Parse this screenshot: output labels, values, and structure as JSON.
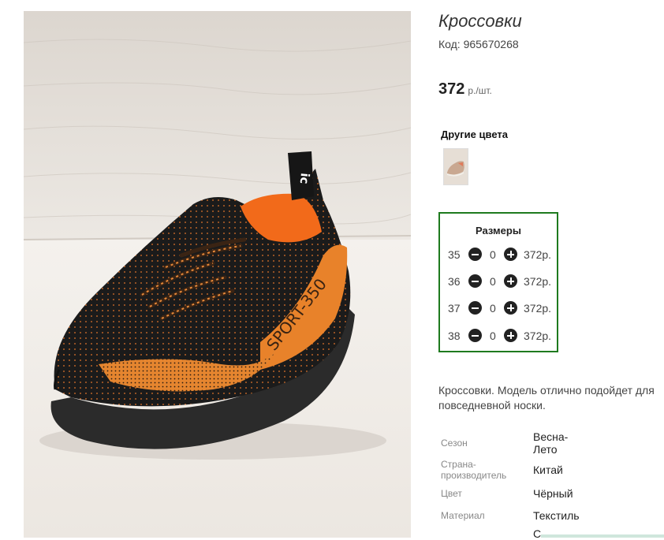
{
  "product": {
    "title": "Кроссовки",
    "code": "Код: 965670268",
    "price_amount": "372",
    "price_unit": "р./шт.",
    "other_colors_title": "Другие цвета",
    "sizes_title": "Размеры",
    "sizes": [
      {
        "size": "35",
        "qty": "0",
        "price": "372р."
      },
      {
        "size": "36",
        "qty": "0",
        "price": "372р."
      },
      {
        "size": "37",
        "qty": "0",
        "price": "372р."
      },
      {
        "size": "38",
        "qty": "0",
        "price": "372р."
      }
    ],
    "description": "Кроссовки. Модель отлично подойдет для повседневной носки.",
    "specs": [
      {
        "label": "Сезон",
        "value": "Весна-\nЛето"
      },
      {
        "label": "Страна-\nпроизводитель",
        "value": "Китай"
      },
      {
        "label": "Цвет",
        "value": "Чёрный"
      },
      {
        "label": "Материал",
        "value": "Текстиль"
      },
      {
        "label": "",
        "value": "С"
      }
    ],
    "shoe_text": "SPORT-350"
  },
  "colors": {
    "frame_green": "#1e7a1e",
    "shoe_orange": "#f07a1c",
    "shoe_black": "#1b1b1b"
  }
}
